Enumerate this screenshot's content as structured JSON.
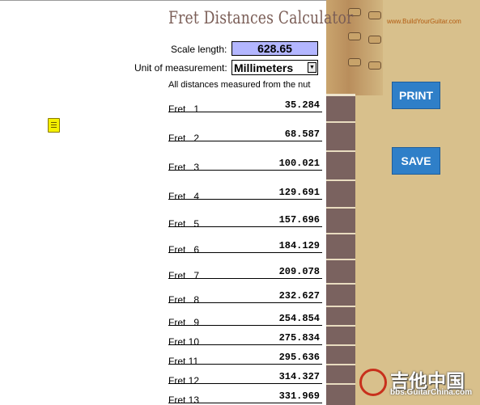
{
  "header": {
    "title": "Fret Distances Calculator",
    "scale_label": "Scale length:",
    "scale_value": "628.65",
    "unit_label": "Unit of measurement:",
    "unit_value": "Millimeters",
    "note": "All distances measured from the nut"
  },
  "brand": "www.BuildYourGuitar.com",
  "buttons": {
    "print": "PRINT",
    "save": "SAVE"
  },
  "frets": [
    {
      "label": "Fret   1",
      "value": "35.284"
    },
    {
      "label": "Fret   2",
      "value": "68.587"
    },
    {
      "label": "Fret   3",
      "value": "100.021"
    },
    {
      "label": "Fret   4",
      "value": "129.691"
    },
    {
      "label": "Fret   5",
      "value": "157.696"
    },
    {
      "label": "Fret   6",
      "value": "184.129"
    },
    {
      "label": "Fret   7",
      "value": "209.078"
    },
    {
      "label": "Fret   8",
      "value": "232.627"
    },
    {
      "label": "Fret   9",
      "value": "254.854"
    },
    {
      "label": "Fret 10",
      "value": "275.834"
    },
    {
      "label": "Fret 11",
      "value": "295.636"
    },
    {
      "label": "Fret 12",
      "value": "314.327"
    },
    {
      "label": "Fret 13",
      "value": "331.969"
    }
  ],
  "watermark": {
    "chinese": "吉他中国",
    "url": "bbs.GuitarChina.com"
  },
  "colors": {
    "scale_box": "#b3b6ff",
    "button": "#2f7fc8",
    "title": "#7a5d56",
    "fretboard": "#7a625f",
    "panel": "#d8c08c"
  },
  "icons": {
    "note": "sticky-note-icon",
    "dropdown": "chevron-down-icon"
  }
}
